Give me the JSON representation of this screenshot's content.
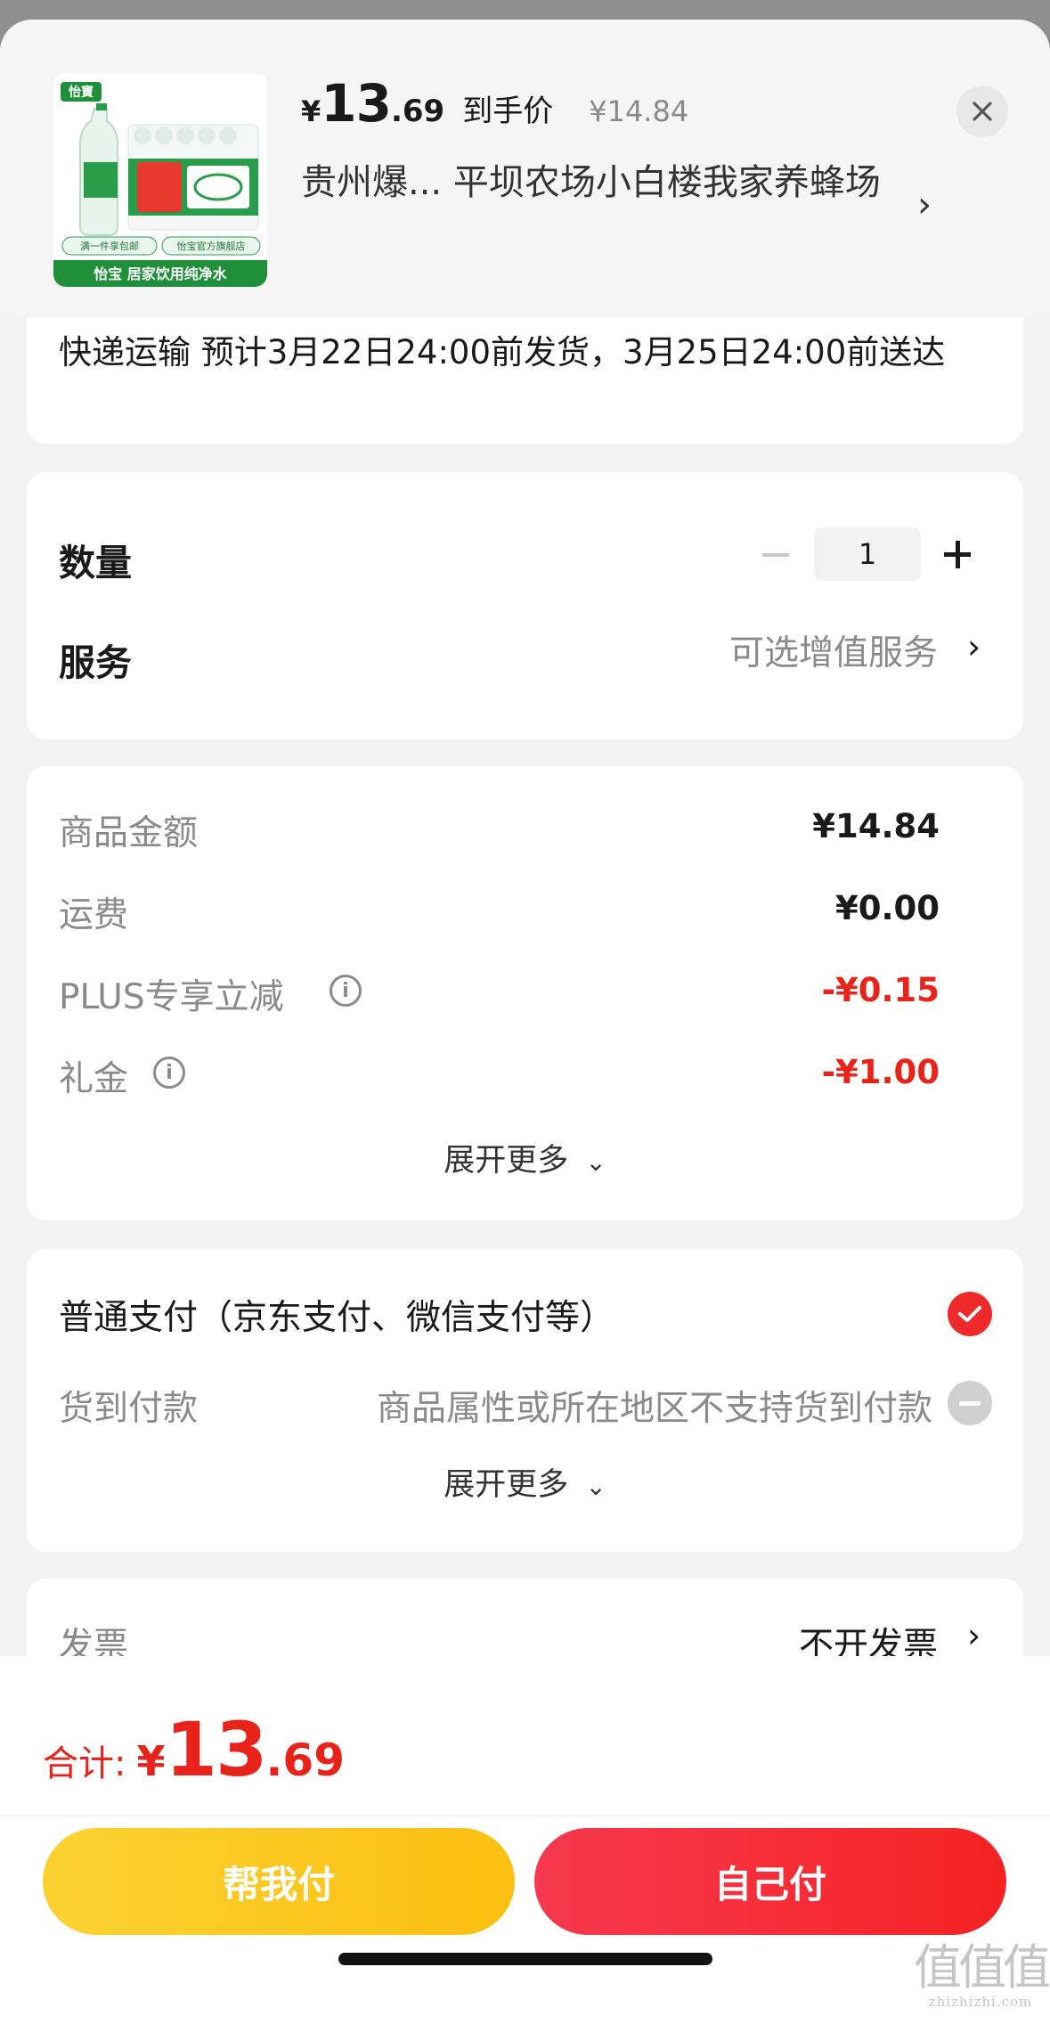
{
  "header": {
    "price_symbol": "¥",
    "price_integer": "13",
    "price_decimal": ".69",
    "price_label": "到手价",
    "original_price": "¥14.84",
    "store_name": "贵州爆... 平坝农场小白楼我家养蜂场",
    "product_image": {
      "brand_mark": "怡寶",
      "badge_left": "满一件享包邮",
      "badge_right": "怡宝官方旗舰店",
      "tagline": "怡宝 居家饮用纯净水"
    }
  },
  "shipping": {
    "text": "快递运输 预计3月22日24:00前发货，3月25日24:00前送达"
  },
  "quantity": {
    "label": "数量",
    "value": "1"
  },
  "service": {
    "label": "服务",
    "value": "可选增值服务"
  },
  "amounts": {
    "items": [
      {
        "label": "商品金额",
        "value": "¥14.84",
        "highlight": false
      },
      {
        "label": "运费",
        "value": "¥0.00",
        "highlight": false
      },
      {
        "label": "PLUS专享立减",
        "value": "-¥0.15",
        "highlight": true
      },
      {
        "label": "礼金",
        "value": "-¥1.00",
        "highlight": true
      }
    ],
    "expand_label": "展开更多"
  },
  "payment": {
    "main_option": "普通支付（京东支付、微信支付等）",
    "cod_label": "货到付款",
    "cod_note": "商品属性或所在地区不支持货到付款",
    "expand_label": "展开更多"
  },
  "invoice": {
    "label": "发票",
    "value": "不开发票"
  },
  "footer": {
    "total_label": "合计:",
    "total_symbol": "¥",
    "total_integer": "13",
    "total_decimal": ".69",
    "help_pay_label": "帮我付",
    "self_pay_label": "自己付"
  },
  "watermark": {
    "text": "值值值",
    "domain": "zhizhizhi.com"
  },
  "colors": {
    "accent_red": "#e8231a",
    "help_button": "#fbbf10",
    "self_button": "#f52222"
  }
}
